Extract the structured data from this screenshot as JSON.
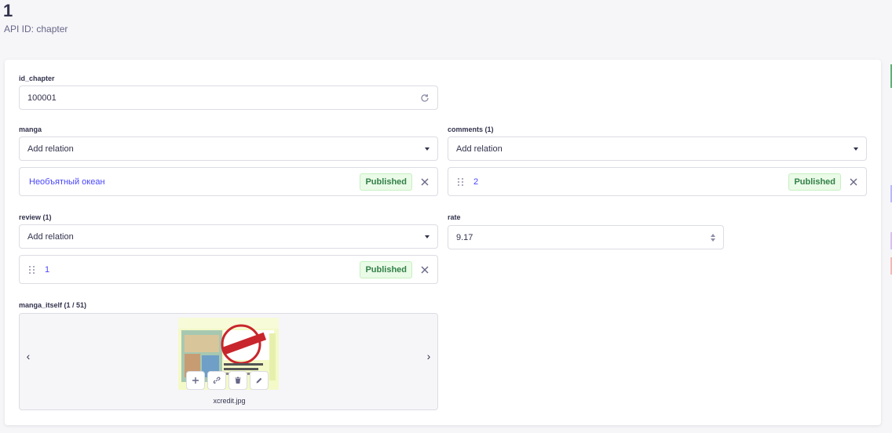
{
  "header": {
    "title": "1",
    "api_id": "API ID: chapter"
  },
  "fields": {
    "id_chapter": {
      "label": "id_chapter",
      "value": "100001",
      "icon": "reload-icon"
    },
    "manga": {
      "label": "manga",
      "placeholder": "Add relation",
      "item": {
        "title": "Необъятный океан",
        "status": "Published"
      }
    },
    "comments": {
      "label": "comments (1)",
      "placeholder": "Add relation",
      "item": {
        "title": "2",
        "status": "Published"
      }
    },
    "review": {
      "label": "review (1)",
      "placeholder": "Add relation",
      "item": {
        "title": "1",
        "status": "Published"
      }
    },
    "rate": {
      "label": "rate",
      "value": "9.17"
    },
    "manga_itself": {
      "label": "manga_itself (1 / 51)",
      "filename": "xcredit.jpg",
      "actions": [
        "plus-icon",
        "link-icon",
        "trash-icon",
        "pencil-icon"
      ]
    }
  },
  "colors": {
    "accent": "#4945ff",
    "success": "#328048",
    "success_bg": "#eafbe7"
  }
}
